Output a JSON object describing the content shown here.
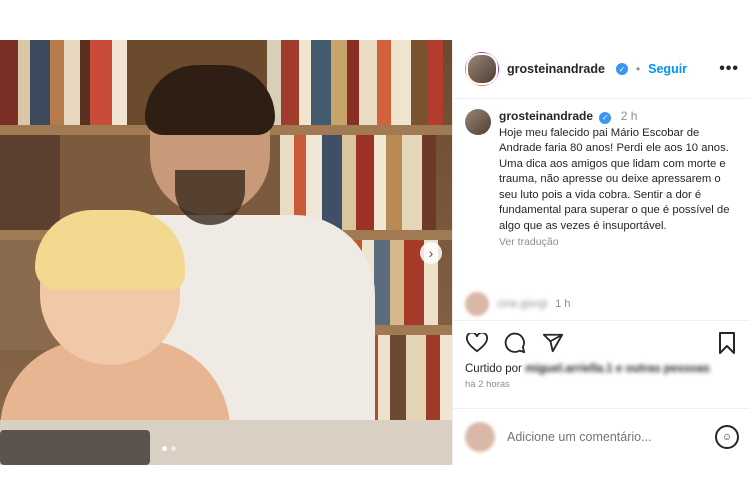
{
  "post": {
    "username": "grosteinandrade",
    "follow_label": "Seguir",
    "more_label": "•••",
    "separator": "•",
    "verified_glyph": "✓"
  },
  "caption": {
    "username": "grosteinandrade",
    "time": "2 h",
    "text": "Hoje meu falecido pai Mário Escobar de Andrade faria 80 anos! Perdi ele aos 10 anos. Uma dica aos amigos que lidam com morte e trauma, não apresse ou deixe apressarem o seu luto pois a vida cobra. Sentir a dor é fundamental para superar o que é possível de algo que as vezes é insuportável.",
    "translate_label": "Ver tradução"
  },
  "comment": {
    "username": "cine.giorgi",
    "time": "1 h"
  },
  "actions": {
    "liked_prefix": "Curtido por",
    "liked_names": "miguel.arriella.1 e outras pessoas",
    "time_ago": "há 2 horas"
  },
  "add_comment": {
    "placeholder": "Adicione um comentário..."
  },
  "icons": {
    "like": "heart-icon",
    "comment": "comment-icon",
    "share": "share-icon",
    "save": "bookmark-icon",
    "emoji": "emoji-icon",
    "next": "chevron-right-icon"
  },
  "colors": {
    "link": "#0095f6",
    "verified": "#3897f0",
    "muted": "#8e8e8e"
  }
}
